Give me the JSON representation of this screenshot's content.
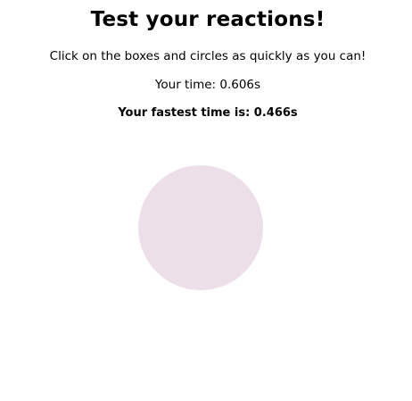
{
  "page": {
    "title": "Test your reactions!",
    "instructions": "Click on the boxes and circles as quickly as you can!"
  },
  "stats": {
    "your_time_label": "Your time: 0.606s",
    "fastest_time_label": "Your fastest time is: 0.466s"
  },
  "target": {
    "shape": "circle",
    "color": "#ecdfe8"
  }
}
